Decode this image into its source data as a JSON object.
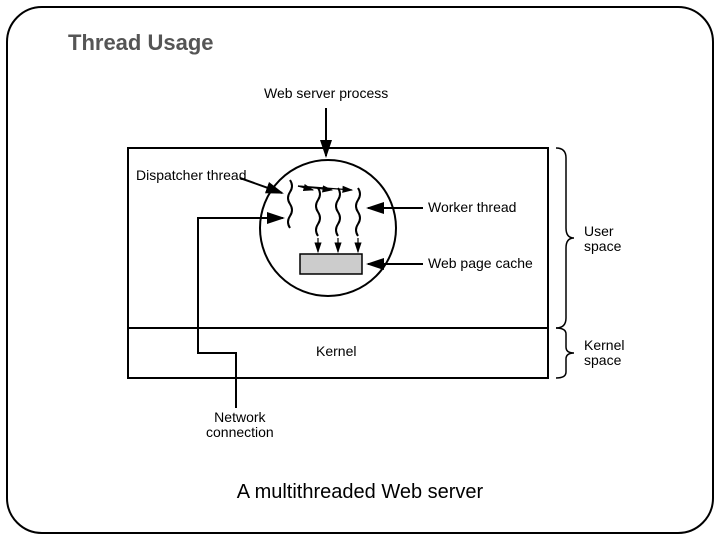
{
  "title": "Thread Usage",
  "caption": "A multithreaded Web server",
  "labels": {
    "web_server_process": "Web server process",
    "dispatcher_thread": "Dispatcher thread",
    "worker_thread": "Worker thread",
    "web_page_cache": "Web page cache",
    "kernel": "Kernel",
    "network_connection": "Network\nconnection",
    "user_space": "User\nspace",
    "kernel_space": "Kernel\nspace"
  }
}
